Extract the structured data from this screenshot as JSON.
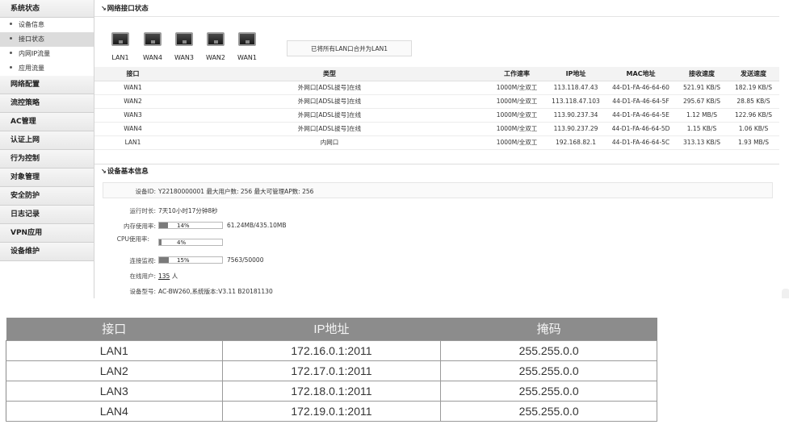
{
  "sidebar": {
    "groups": [
      {
        "label": "系统状态",
        "items": [
          {
            "label": "设备信息"
          },
          {
            "label": "接口状态"
          },
          {
            "label": "内网IP流量"
          },
          {
            "label": "应用流量"
          }
        ]
      },
      {
        "label": "网络配置"
      },
      {
        "label": "流控策略"
      },
      {
        "label": "AC管理"
      },
      {
        "label": "认证上网"
      },
      {
        "label": "行为控制"
      },
      {
        "label": "对象管理"
      },
      {
        "label": "安全防护"
      },
      {
        "label": "日志记录"
      },
      {
        "label": "VPN应用"
      },
      {
        "label": "设备维护"
      }
    ],
    "selected_item": "接口状态"
  },
  "network_status": {
    "title": "网络接口状态",
    "ports": [
      "LAN1",
      "WAN4",
      "WAN3",
      "WAN2",
      "WAN1"
    ],
    "merge_note": "已将所有LAN口合并为LAN1",
    "columns": [
      "接口",
      "类型",
      "工作速率",
      "IP地址",
      "MAC地址",
      "接收速度",
      "发送速度"
    ],
    "rows": [
      [
        "WAN1",
        "外网口[ADSL拔号]在线",
        "1000M/全双工",
        "113.118.47.43",
        "44-D1-FA-46-64-60",
        "521.91 KB/S",
        "182.19 KB/S"
      ],
      [
        "WAN2",
        "外网口[ADSL拔号]在线",
        "1000M/全双工",
        "113.118.47.103",
        "44-D1-FA-46-64-5F",
        "295.67 KB/S",
        "28.85 KB/S"
      ],
      [
        "WAN3",
        "外网口[ADSL拔号]在线",
        "1000M/全双工",
        "113.90.237.34",
        "44-D1-FA-46-64-5E",
        "1.12 MB/S",
        "122.96 KB/S"
      ],
      [
        "WAN4",
        "外网口[ADSL拔号]在线",
        "1000M/全双工",
        "113.90.237.29",
        "44-D1-FA-46-64-5D",
        "1.15 KB/S",
        "1.06 KB/S"
      ],
      [
        "LAN1",
        "内网口",
        "1000M/全双工",
        "192.168.82.1",
        "44-D1-FA-46-64-5C",
        "313.13 KB/S",
        "1.93 MB/S"
      ]
    ]
  },
  "device_info": {
    "title": "设备基本信息",
    "device_id_label": "设备ID:",
    "device_id_text": "Y22180000001 最大用户数: 256 最大可管理AP数: 256",
    "uptime_label": "运行时长:",
    "uptime_value": "7天10小时17分钟8秒",
    "memory_label": "内存使用率:",
    "memory_pct": "14%",
    "memory_fraction": 0.14,
    "memory_detail": "61.24MB/435.10MB",
    "cpu_label": "CPU使用率:",
    "cpu_pct": "4%",
    "cpu_fraction": 0.04,
    "conn_label": "连接监视:",
    "conn_pct": "15%",
    "conn_fraction": 0.15,
    "conn_detail": "7563/50000",
    "online_label": "在线用户:",
    "online_count": "135",
    "online_unit": "人",
    "model_label": "设备型号:",
    "model_value": "AC-BW260,系统版本:V3.11 B20181130"
  },
  "lan_table": {
    "columns": [
      "接口",
      "IP地址",
      "掩码"
    ],
    "rows": [
      [
        "LAN1",
        "172.16.0.1:2011",
        "255.255.0.0"
      ],
      [
        "LAN2",
        "172.17.0.1:2011",
        "255.255.0.0"
      ],
      [
        "LAN3",
        "172.18.0.1:2011",
        "255.255.0.0"
      ],
      [
        "LAN4",
        "172.19.0.1:2011",
        "255.255.0.0"
      ]
    ]
  }
}
